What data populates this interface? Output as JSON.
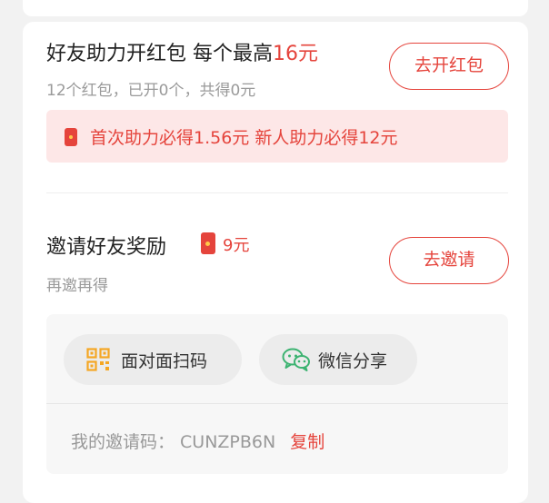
{
  "colors": {
    "accent": "#e5443c",
    "banner_bg": "#fde7e7",
    "panel_bg": "#f7f7f7",
    "qr_icon": "#f5a623",
    "wechat_icon": "#3cb371"
  },
  "redpack_section": {
    "title_main": "好友助力开红包 每个最高",
    "title_amount": "16元",
    "summary": "12个红包，已开0个，共得0元",
    "button_label": "去开红包",
    "banner_text": "首次助力必得1.56元 新人助力必得12元",
    "banner_icon": "red-envelope-icon"
  },
  "invite_section": {
    "title": "邀请好友奖励",
    "reward_icon": "red-envelope-icon",
    "reward_amount": "9元",
    "subtitle": "再邀再得",
    "button_label": "去邀请",
    "share_options": [
      {
        "label": "面对面扫码",
        "icon": "qr-code-icon"
      },
      {
        "label": "微信分享",
        "icon": "wechat-icon"
      }
    ],
    "invite_code_label": "我的邀请码：",
    "invite_code": "CUNZPB6N",
    "copy_label": "复制"
  }
}
